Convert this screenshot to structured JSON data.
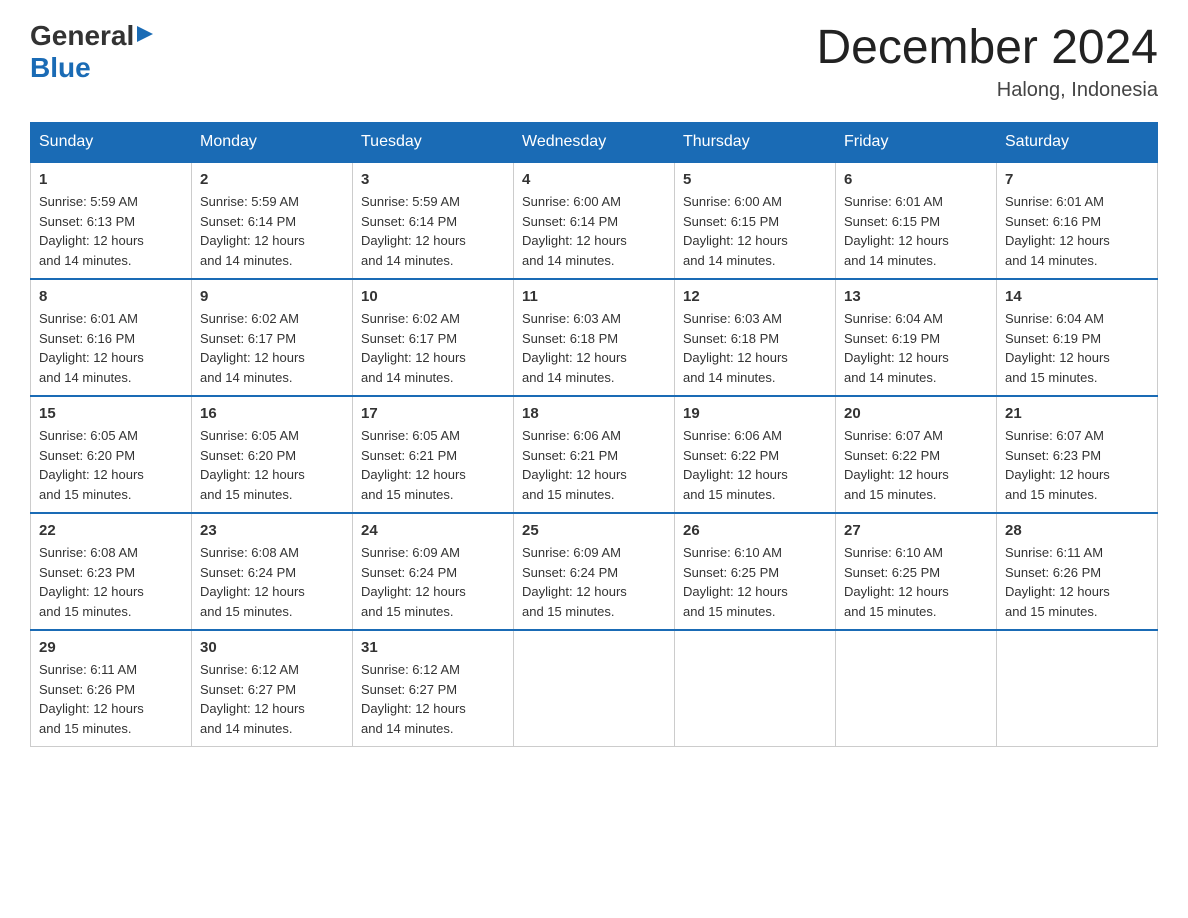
{
  "logo": {
    "general": "General",
    "blue": "Blue"
  },
  "title": {
    "month_year": "December 2024",
    "location": "Halong, Indonesia"
  },
  "days_of_week": [
    "Sunday",
    "Monday",
    "Tuesday",
    "Wednesday",
    "Thursday",
    "Friday",
    "Saturday"
  ],
  "weeks": [
    [
      {
        "day": "1",
        "sunrise": "5:59 AM",
        "sunset": "6:13 PM",
        "daylight": "12 hours and 14 minutes."
      },
      {
        "day": "2",
        "sunrise": "5:59 AM",
        "sunset": "6:14 PM",
        "daylight": "12 hours and 14 minutes."
      },
      {
        "day": "3",
        "sunrise": "5:59 AM",
        "sunset": "6:14 PM",
        "daylight": "12 hours and 14 minutes."
      },
      {
        "day": "4",
        "sunrise": "6:00 AM",
        "sunset": "6:14 PM",
        "daylight": "12 hours and 14 minutes."
      },
      {
        "day": "5",
        "sunrise": "6:00 AM",
        "sunset": "6:15 PM",
        "daylight": "12 hours and 14 minutes."
      },
      {
        "day": "6",
        "sunrise": "6:01 AM",
        "sunset": "6:15 PM",
        "daylight": "12 hours and 14 minutes."
      },
      {
        "day": "7",
        "sunrise": "6:01 AM",
        "sunset": "6:16 PM",
        "daylight": "12 hours and 14 minutes."
      }
    ],
    [
      {
        "day": "8",
        "sunrise": "6:01 AM",
        "sunset": "6:16 PM",
        "daylight": "12 hours and 14 minutes."
      },
      {
        "day": "9",
        "sunrise": "6:02 AM",
        "sunset": "6:17 PM",
        "daylight": "12 hours and 14 minutes."
      },
      {
        "day": "10",
        "sunrise": "6:02 AM",
        "sunset": "6:17 PM",
        "daylight": "12 hours and 14 minutes."
      },
      {
        "day": "11",
        "sunrise": "6:03 AM",
        "sunset": "6:18 PM",
        "daylight": "12 hours and 14 minutes."
      },
      {
        "day": "12",
        "sunrise": "6:03 AM",
        "sunset": "6:18 PM",
        "daylight": "12 hours and 14 minutes."
      },
      {
        "day": "13",
        "sunrise": "6:04 AM",
        "sunset": "6:19 PM",
        "daylight": "12 hours and 14 minutes."
      },
      {
        "day": "14",
        "sunrise": "6:04 AM",
        "sunset": "6:19 PM",
        "daylight": "12 hours and 15 minutes."
      }
    ],
    [
      {
        "day": "15",
        "sunrise": "6:05 AM",
        "sunset": "6:20 PM",
        "daylight": "12 hours and 15 minutes."
      },
      {
        "day": "16",
        "sunrise": "6:05 AM",
        "sunset": "6:20 PM",
        "daylight": "12 hours and 15 minutes."
      },
      {
        "day": "17",
        "sunrise": "6:05 AM",
        "sunset": "6:21 PM",
        "daylight": "12 hours and 15 minutes."
      },
      {
        "day": "18",
        "sunrise": "6:06 AM",
        "sunset": "6:21 PM",
        "daylight": "12 hours and 15 minutes."
      },
      {
        "day": "19",
        "sunrise": "6:06 AM",
        "sunset": "6:22 PM",
        "daylight": "12 hours and 15 minutes."
      },
      {
        "day": "20",
        "sunrise": "6:07 AM",
        "sunset": "6:22 PM",
        "daylight": "12 hours and 15 minutes."
      },
      {
        "day": "21",
        "sunrise": "6:07 AM",
        "sunset": "6:23 PM",
        "daylight": "12 hours and 15 minutes."
      }
    ],
    [
      {
        "day": "22",
        "sunrise": "6:08 AM",
        "sunset": "6:23 PM",
        "daylight": "12 hours and 15 minutes."
      },
      {
        "day": "23",
        "sunrise": "6:08 AM",
        "sunset": "6:24 PM",
        "daylight": "12 hours and 15 minutes."
      },
      {
        "day": "24",
        "sunrise": "6:09 AM",
        "sunset": "6:24 PM",
        "daylight": "12 hours and 15 minutes."
      },
      {
        "day": "25",
        "sunrise": "6:09 AM",
        "sunset": "6:24 PM",
        "daylight": "12 hours and 15 minutes."
      },
      {
        "day": "26",
        "sunrise": "6:10 AM",
        "sunset": "6:25 PM",
        "daylight": "12 hours and 15 minutes."
      },
      {
        "day": "27",
        "sunrise": "6:10 AM",
        "sunset": "6:25 PM",
        "daylight": "12 hours and 15 minutes."
      },
      {
        "day": "28",
        "sunrise": "6:11 AM",
        "sunset": "6:26 PM",
        "daylight": "12 hours and 15 minutes."
      }
    ],
    [
      {
        "day": "29",
        "sunrise": "6:11 AM",
        "sunset": "6:26 PM",
        "daylight": "12 hours and 15 minutes."
      },
      {
        "day": "30",
        "sunrise": "6:12 AM",
        "sunset": "6:27 PM",
        "daylight": "12 hours and 14 minutes."
      },
      {
        "day": "31",
        "sunrise": "6:12 AM",
        "sunset": "6:27 PM",
        "daylight": "12 hours and 14 minutes."
      },
      null,
      null,
      null,
      null
    ]
  ],
  "labels": {
    "sunrise": "Sunrise:",
    "sunset": "Sunset:",
    "daylight": "Daylight:"
  }
}
